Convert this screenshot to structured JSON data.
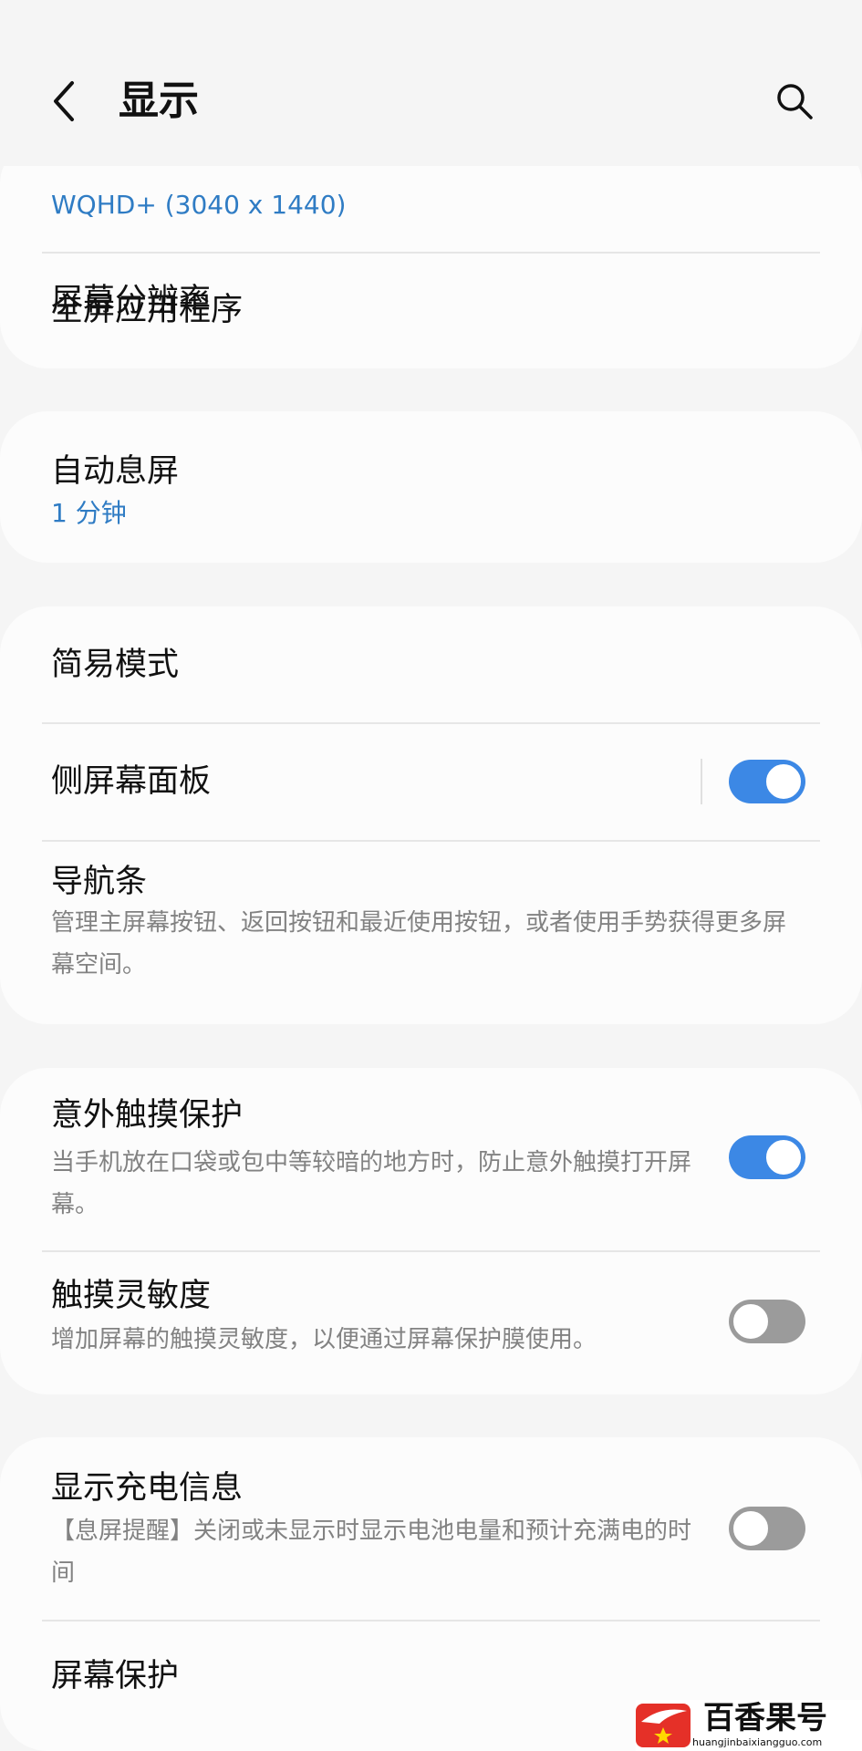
{
  "header": {
    "title": "显示",
    "back_icon": "chevron-left-icon",
    "search_icon": "search-icon"
  },
  "cards": [
    {
      "items": [
        {
          "title": "屏幕分辨率",
          "subtitle": "WQHD+ (3040 x 1440)"
        },
        {
          "title": "全屏应用程序"
        }
      ]
    },
    {
      "items": [
        {
          "title": "自动息屏",
          "subtitle": "1 分钟"
        }
      ]
    },
    {
      "items": [
        {
          "title": "简易模式"
        },
        {
          "title": "侧屏幕面板",
          "toggle_on": true
        },
        {
          "title": "导航条",
          "description": "管理主屏幕按钮、返回按钮和最近使用按钮，或者使用手势获得更多屏幕空间。"
        }
      ]
    },
    {
      "items": [
        {
          "title": "意外触摸保护",
          "description": "当手机放在口袋或包中等较暗的地方时，防止意外触摸打开屏幕。",
          "toggle_on": true
        },
        {
          "title": "触摸灵敏度",
          "description": "增加屏幕的触摸灵敏度，以便通过屏幕保护膜使用。",
          "toggle_on": false
        }
      ]
    },
    {
      "items": [
        {
          "title": "显示充电信息",
          "description": "【息屏提醒】关闭或未显示时显示电池电量和预计充满电的时间",
          "toggle_on": false
        },
        {
          "title": "屏幕保护"
        }
      ]
    }
  ],
  "watermark": {
    "name": "百香果号",
    "url": "huangjinbaixiangguo.com"
  },
  "colors": {
    "background": "#f5f5f5",
    "card": "#fcfcfc",
    "accent_blue": "#3c88e5",
    "subtitle_blue": "#2f7cc4",
    "toggle_off": "#9b9b9b",
    "description_gray": "#828282"
  }
}
